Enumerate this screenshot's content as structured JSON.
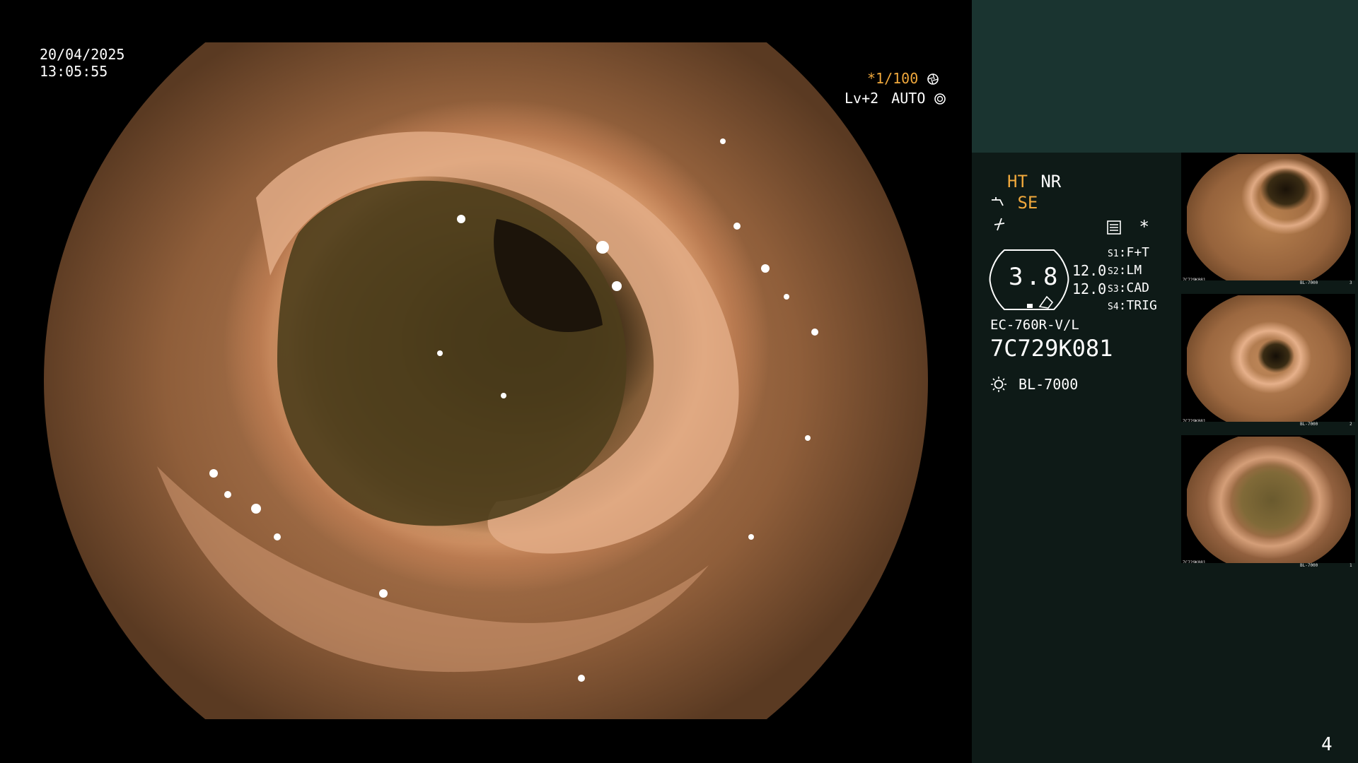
{
  "osd": {
    "date": "20/04/2025",
    "time": "13:05:55",
    "shutter": "*1/100",
    "level": "Lv+2",
    "mode": "AUTO"
  },
  "panel": {
    "mode_ht": "HT",
    "mode_nr": "NR",
    "mode_se": "SE",
    "gauge_value": "3.8",
    "side_value_1": "12.0",
    "side_value_2": "12.0",
    "switches": [
      {
        "key": "S1",
        "value": "F+T"
      },
      {
        "key": "S2",
        "value": "LM"
      },
      {
        "key": "S3",
        "value": "CAD"
      },
      {
        "key": "S4",
        "value": "TRIG"
      }
    ],
    "asterisk": "*",
    "scope_model": "EC-760R-V/L",
    "scope_serial": "7C729K081",
    "light_source": "BL-7000",
    "page_number": "4"
  },
  "thumbnails": [
    {
      "serial": "7C729K081",
      "light": "BL-7000",
      "index": "3"
    },
    {
      "serial": "7C729K081",
      "light": "BL-7000",
      "index": "2"
    },
    {
      "serial": "7C729K081",
      "light": "BL-7000",
      "index": "1"
    }
  ],
  "colors": {
    "accent_yellow": "#f0a83c",
    "panel_bg": "#0e1a17",
    "panel_top": "#1a3430"
  },
  "icons": {
    "shutter": "aperture-icon",
    "mode": "iris-icon",
    "se": "scope-tip-icon",
    "slash": "slash-icon",
    "menu": "menu-list-icon",
    "light": "sun-icon"
  }
}
